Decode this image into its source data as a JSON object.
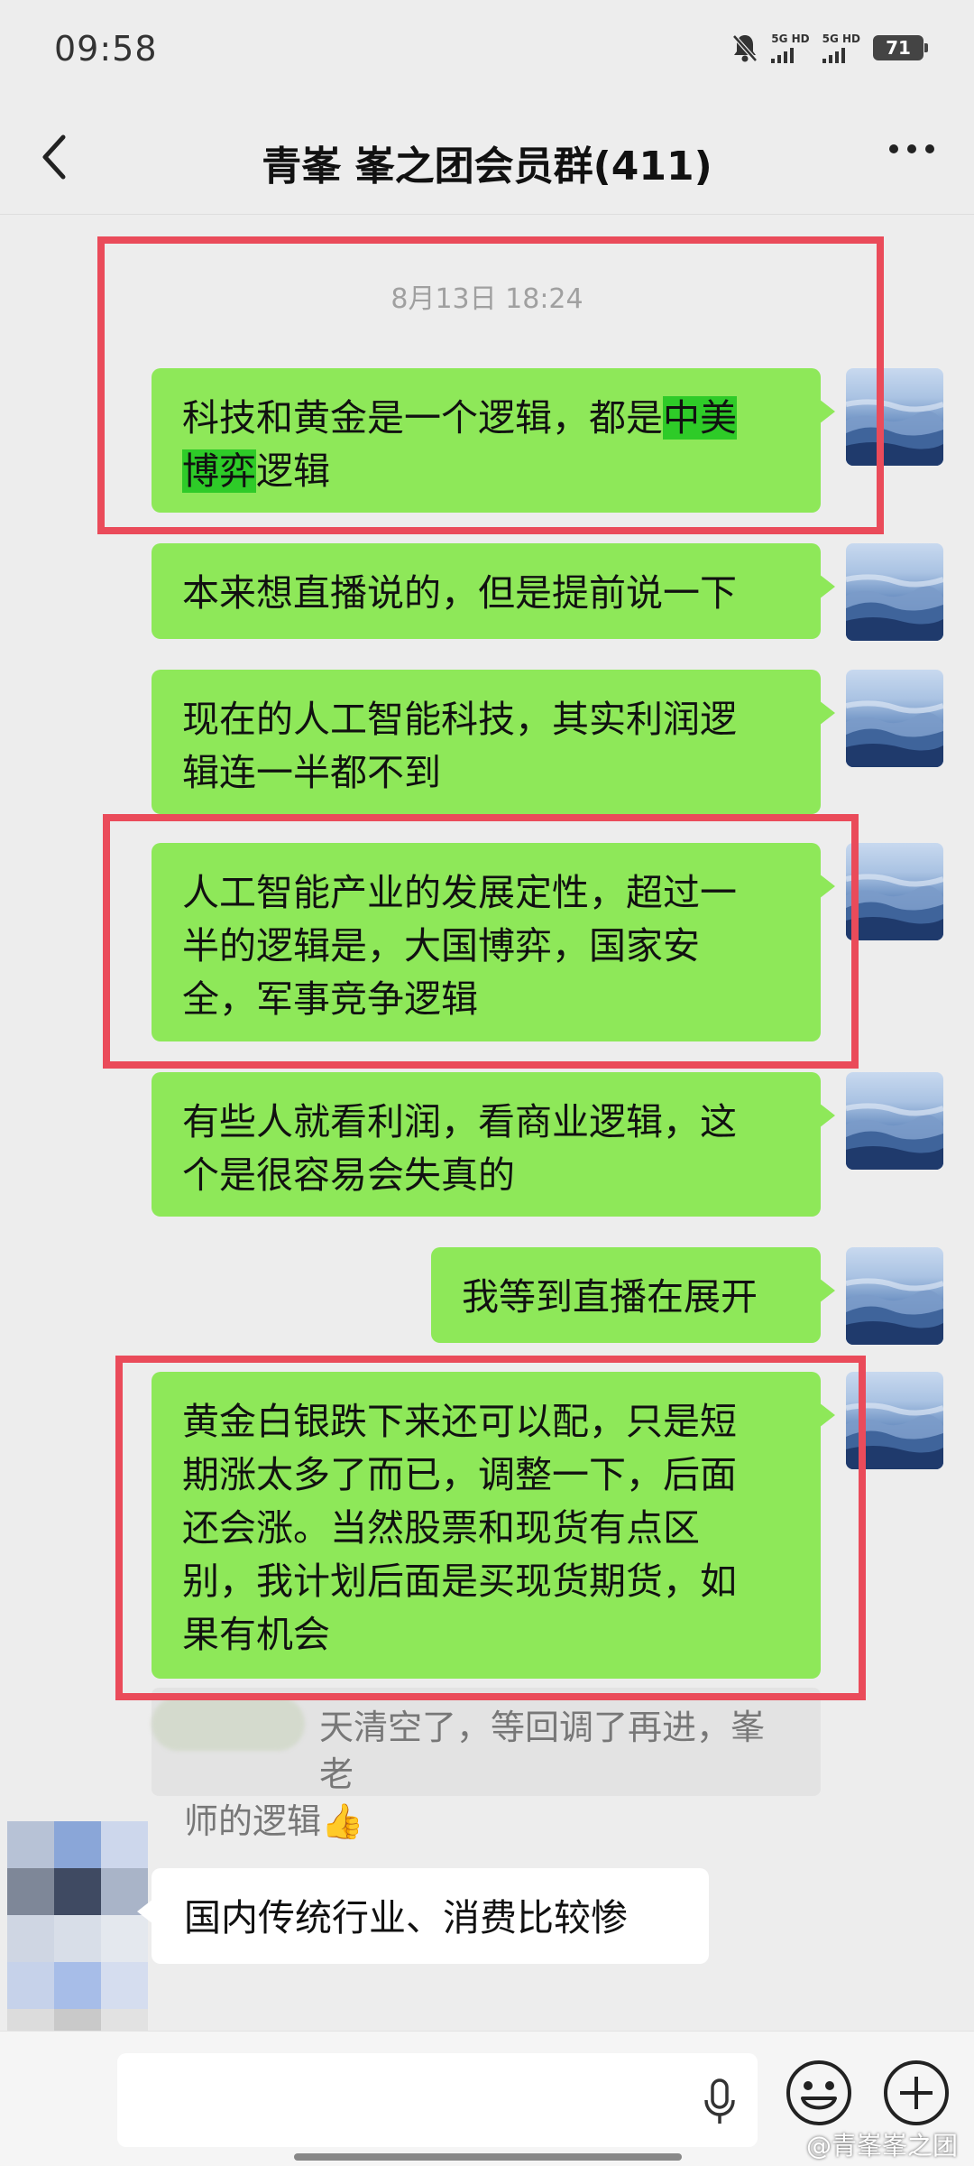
{
  "status_bar": {
    "time": "09:58",
    "net1": "5G HD",
    "net2": "5G HD",
    "battery": "71"
  },
  "header": {
    "title": "青峯 峯之团会员群(411)",
    "back_icon": "chevron-left-icon",
    "more_icon": "more-icon"
  },
  "chat": {
    "timestamp": "8月13日 18:24",
    "messages": [
      {
        "line1_pre": "科技和黄金是一个逻辑，都是",
        "line1_hl": "中美",
        "line2_hl": "博弈",
        "line2_post": "逻辑"
      },
      {
        "text": "本来想直播说的，但是提前说一下"
      },
      {
        "line1": "现在的人工智能科技，其实利润逻",
        "line2": "辑连一半都不到"
      },
      {
        "line1": "人工智能产业的发展定性，超过一",
        "line2": "半的逻辑是，大国博弈，国家安",
        "line3": "全，军事竞争逻辑"
      },
      {
        "line1": "有些人就看利润，看商业逻辑，这",
        "line2": "个是很容易会失真的"
      },
      {
        "text": "我等到直播在展开"
      },
      {
        "line1": "黄金白银跌下来还可以配，只是短",
        "line2": "期涨太多了而已，调整一下，后面",
        "line3": "还会涨。当然股票和现货有点区",
        "line4": "别，我计划后面是买现货期货，如",
        "line5": "果有机会"
      }
    ],
    "quoted": {
      "line1": "天清空了，等回调了再进，峯老",
      "line2": "师的逻辑👍"
    },
    "incoming": {
      "text": "国内传统行业、消费比较惨"
    }
  },
  "input_bar": {
    "mic_icon": "microphone-icon",
    "emoji_icon": "emoji-icon",
    "plus_icon": "plus-icon"
  },
  "watermark": "@青峯峯之团",
  "colors": {
    "bubble_green": "#8ee859",
    "highlight_green": "#2ecb28",
    "frame_red": "#ea4b5a",
    "background": "#ededed"
  }
}
